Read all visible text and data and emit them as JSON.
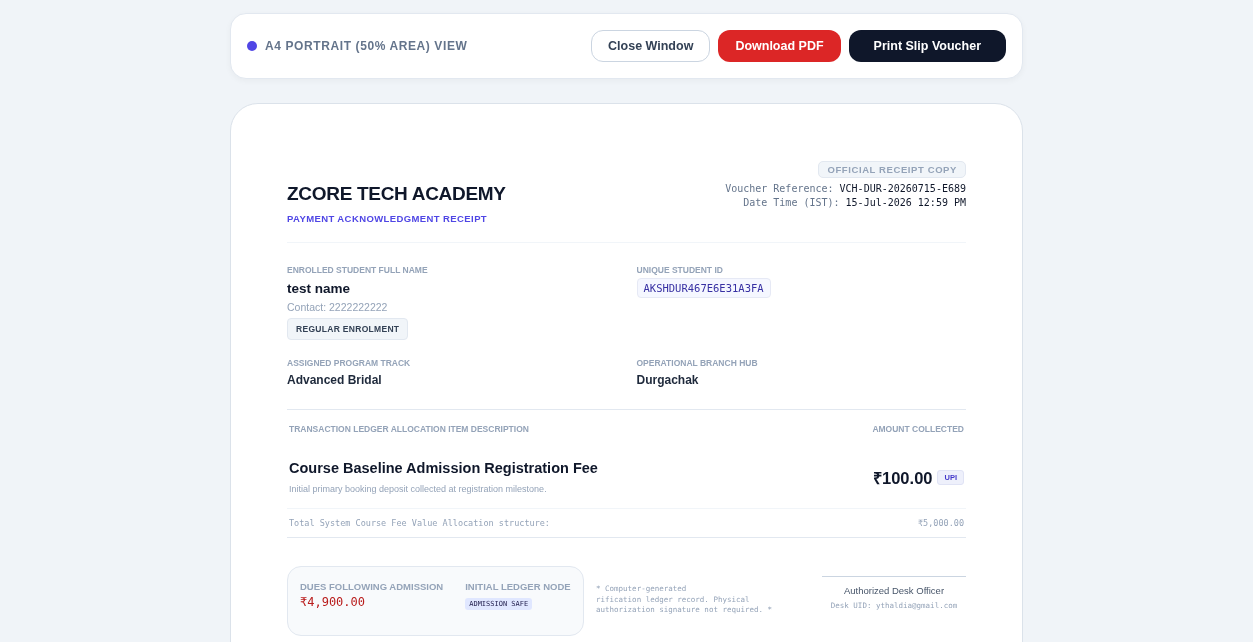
{
  "toolbar": {
    "view_label": "A4 PORTRAIT (50% AREA) VIEW",
    "buttons": [
      {
        "label": "Close Window",
        "kind": "outline"
      },
      {
        "label": "Download PDF",
        "kind": "danger"
      },
      {
        "label": "Print Slip Voucher",
        "kind": "dark"
      }
    ]
  },
  "receipt": {
    "academy": "ZCORE TECH ACADEMY",
    "subtitle": "PAYMENT ACKNOWLEDGMENT RECEIPT",
    "copy_badge": "OFFICIAL RECEIPT COPY",
    "meta": [
      {
        "label": "Voucher Reference:",
        "value": "VCH-DUR-20260715-E689"
      },
      {
        "label": "Date Time (IST):",
        "value": "15-Jul-2026 12:59 PM"
      }
    ],
    "student": {
      "label": "ENROLLED STUDENT FULL NAME",
      "name": "test name",
      "contact": "Contact: 2222222222",
      "badge": "REGULAR ENROLMENT"
    },
    "student_id": {
      "label": "UNIQUE STUDENT ID",
      "value": "AKSHDUR467E6E31A3FA"
    },
    "program": {
      "label": "ASSIGNED PROGRAM TRACK",
      "value": "Advanced Bridal"
    },
    "branch": {
      "label": "OPERATIONAL BRANCH HUB",
      "value": "Durgachak"
    },
    "ledger": {
      "columns": [
        "TRANSACTION LEDGER ALLOCATION ITEM DESCRIPTION",
        "AMOUNT COLLECTED"
      ],
      "item": {
        "title": "Course Baseline Admission Registration Fee",
        "description": "Initial primary booking deposit collected at registration milestone.",
        "amount": "₹100.00",
        "method": "UPI"
      },
      "total": {
        "label": "Total System Course Fee Value Allocation structure:",
        "value": "₹5,000.00"
      }
    },
    "dues": {
      "label": "DUES FOLLOWING ADMISSION",
      "value": "₹4,900.00"
    },
    "ledger_node": {
      "label": "INITIAL LEDGER NODE",
      "badge": "ADMISSION SAFE"
    },
    "footnote": [
      "* Computer-generated",
      "rification ledger record. Physical authorization signature not required. *"
    ],
    "signature": {
      "title": "Authorized Desk Officer",
      "uid": "Desk UID: ythaldia@gmail.com"
    }
  }
}
